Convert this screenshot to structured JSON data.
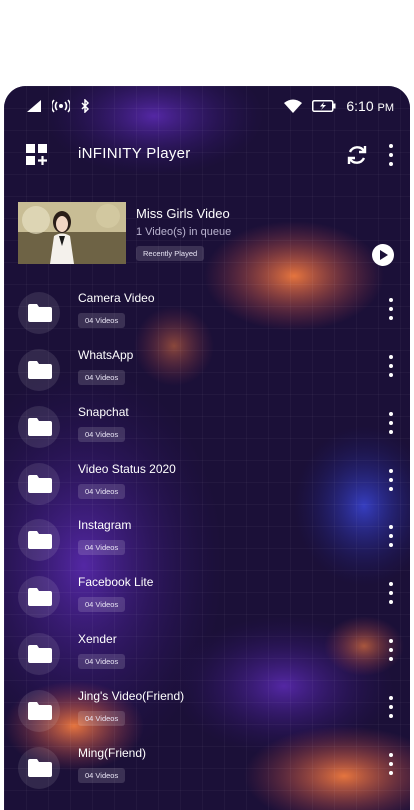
{
  "status_bar": {
    "time": "6:10",
    "ampm": "PM"
  },
  "app": {
    "title": "iNFINITY Player"
  },
  "recent": {
    "title": "Miss Girls Video",
    "subtitle": "1 Video(s) in queue",
    "badge": "Recently Played"
  },
  "folders": [
    {
      "name": "Camera Video",
      "count": "04 Videos"
    },
    {
      "name": "WhatsApp",
      "count": "04 Videos"
    },
    {
      "name": "Snapchat",
      "count": "04 Videos"
    },
    {
      "name": "Video Status 2020",
      "count": "04 Videos"
    },
    {
      "name": "Instagram",
      "count": "04 Videos"
    },
    {
      "name": "Facebook Lite",
      "count": "04 Videos"
    },
    {
      "name": "Xender",
      "count": "04 Videos"
    },
    {
      "name": "Jing's Video(Friend)",
      "count": "04 Videos"
    },
    {
      "name": "Ming(Friend)",
      "count": "04 Videos"
    }
  ],
  "icons": {
    "app": "apps-grid-plus-icon",
    "refresh": "refresh-icon",
    "more": "more-vertical-icon",
    "play": "play-icon",
    "folder": "folder-icon",
    "signal": "signal-icon",
    "hotspot": "hotspot-icon",
    "bluetooth": "bluetooth-icon",
    "wifi": "wifi-icon",
    "battery": "battery-charging-icon"
  },
  "colors": {
    "background": "#1a0f38",
    "accent_blob": "#e0703f",
    "text": "#ffffff"
  }
}
